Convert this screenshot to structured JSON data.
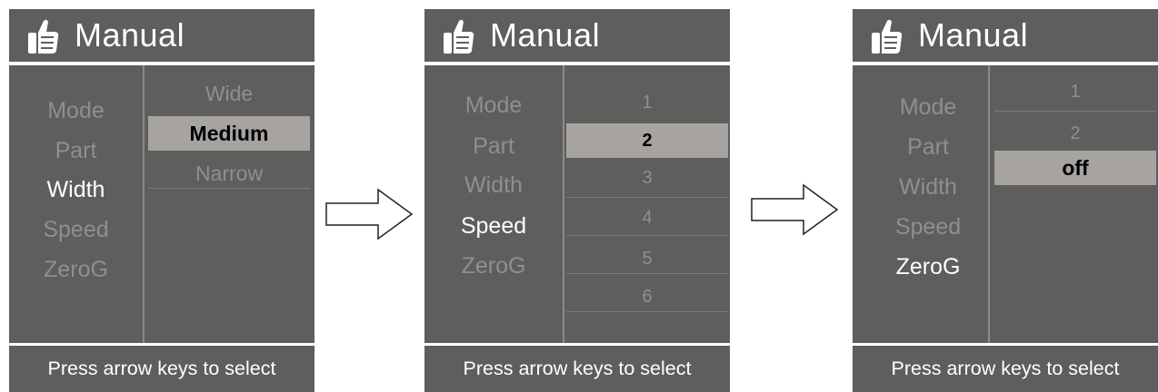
{
  "screens": [
    {
      "title": "Manual",
      "menu": [
        "Mode",
        "Part",
        "Width",
        "Speed",
        "ZeroG"
      ],
      "active_index": 2,
      "options": [
        "Wide",
        "Medium",
        "Narrow"
      ],
      "selected_index": 1,
      "footer": "Press arrow keys to select"
    },
    {
      "title": "Manual",
      "menu": [
        "Mode",
        "Part",
        "Width",
        "Speed",
        "ZeroG"
      ],
      "active_index": 3,
      "options": [
        "1",
        "2",
        "3",
        "4",
        "5",
        "6"
      ],
      "selected_index": 1,
      "footer": "Press arrow keys to select"
    },
    {
      "title": "Manual",
      "menu": [
        "Mode",
        "Part",
        "Width",
        "Speed",
        "ZeroG"
      ],
      "active_index": 4,
      "options": [
        "1",
        "2",
        "off"
      ],
      "selected_index": 2,
      "footer": "Press arrow keys to select"
    }
  ],
  "icons": {
    "header": "thumbs-up-icon",
    "transition": "right-arrow-icon"
  },
  "colors": {
    "panel": "#5e5e5c",
    "highlight": "#a6a3a1",
    "inactive_text": "#8f8f8d",
    "active_text": "#ffffff"
  }
}
